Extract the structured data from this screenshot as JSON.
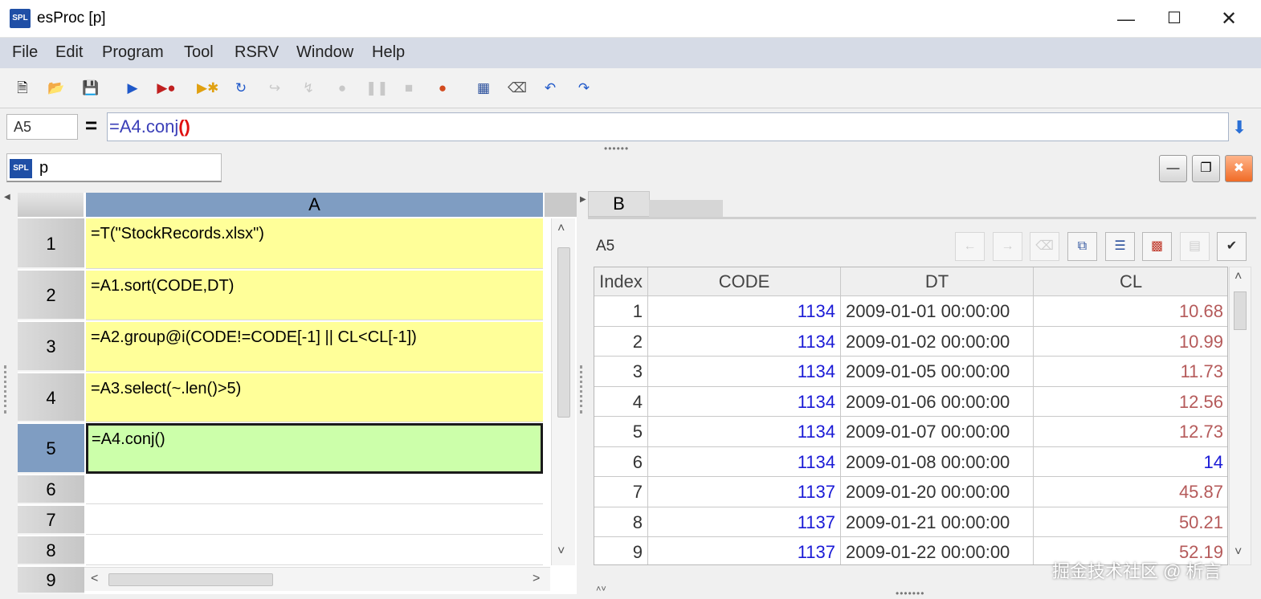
{
  "window": {
    "title": "esProc  [p]",
    "logo": "SPL",
    "minimize_icon": "minimize-icon",
    "maximize_icon": "maximize-icon",
    "close_icon": "close-icon"
  },
  "menu": [
    "File",
    "Edit",
    "Program",
    "Tool",
    "RSRV",
    "Window",
    "Help"
  ],
  "toolbar_icons": [
    "new-file-icon",
    "open-folder-icon",
    "save-icon",
    "run-icon",
    "debug-icon",
    "step-icon",
    "run-to-cursor-icon",
    "step-over-icon",
    "step-into-icon",
    "stop-icon",
    "pause-icon",
    "terminate-icon",
    "breakpoint-icon",
    "calculator-icon",
    "eraser-icon",
    "undo-icon",
    "redo-icon"
  ],
  "formula_bar": {
    "cell_name": "A5",
    "equals": "=",
    "formula": "=A4.conj()",
    "formula_prefix": "=A4.conj",
    "formula_parens": "()"
  },
  "document_tab": {
    "logo": "SPL",
    "name": "p"
  },
  "grid": {
    "column_header": "A",
    "rows": [
      {
        "num": "1",
        "formula": "=T(\"StockRecords.xlsx\")"
      },
      {
        "num": "2",
        "formula": "=A1.sort(CODE,DT)"
      },
      {
        "num": "3",
        "formula": "=A2.group@i(CODE!=CODE[-1] || CL<CL[-1])"
      },
      {
        "num": "4",
        "formula": "=A3.select(~.len()>5)"
      },
      {
        "num": "5",
        "formula": "=A4.conj()"
      },
      {
        "num": "6",
        "formula": ""
      },
      {
        "num": "7",
        "formula": ""
      },
      {
        "num": "8",
        "formula": ""
      },
      {
        "num": "9",
        "formula": ""
      }
    ]
  },
  "result_panel": {
    "tab": "B",
    "cell_name": "A5",
    "columns": [
      "Index",
      "CODE",
      "DT",
      "CL"
    ],
    "rows": [
      [
        "1",
        "1134",
        "2009-01-01 00:00:00",
        "10.68"
      ],
      [
        "2",
        "1134",
        "2009-01-02 00:00:00",
        "10.99"
      ],
      [
        "3",
        "1134",
        "2009-01-05 00:00:00",
        "11.73"
      ],
      [
        "4",
        "1134",
        "2009-01-06 00:00:00",
        "12.56"
      ],
      [
        "5",
        "1134",
        "2009-01-07 00:00:00",
        "12.73"
      ],
      [
        "6",
        "1134",
        "2009-01-08 00:00:00",
        "14"
      ],
      [
        "7",
        "1137",
        "2009-01-20 00:00:00",
        "45.87"
      ],
      [
        "8",
        "1137",
        "2009-01-21 00:00:00",
        "50.21"
      ],
      [
        "9",
        "1137",
        "2009-01-22 00:00:00",
        "52.19"
      ]
    ]
  },
  "watermark": "掘金技术社区 @ 析言",
  "colors": {
    "code_cell": "#ffff99",
    "active_cell": "#ccffaa",
    "header_selected": "#7f9dc2",
    "number_blue": "#1b1bd6",
    "decimal_red": "#b55a5a"
  }
}
